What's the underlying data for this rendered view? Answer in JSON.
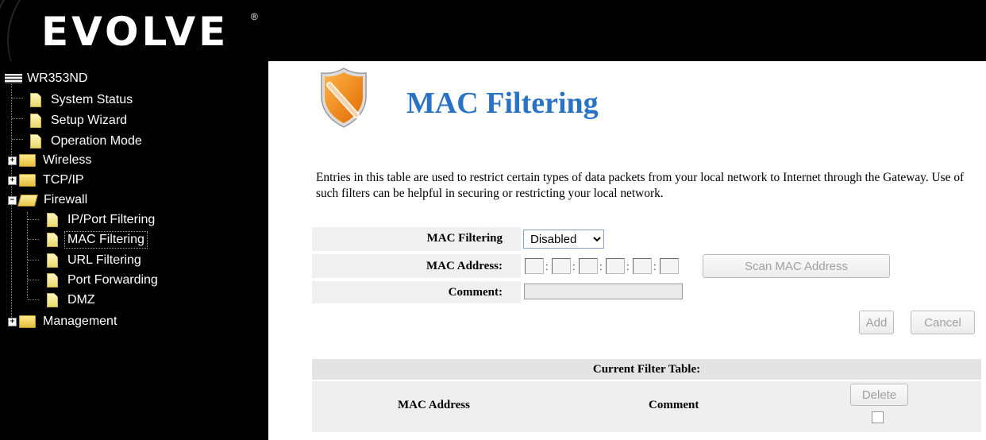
{
  "brand": {
    "logo_text": "EVOLVE",
    "registered_mark": "®"
  },
  "sidebar": {
    "root": "WR353ND",
    "items": [
      {
        "label": "System Status"
      },
      {
        "label": "Setup Wizard"
      },
      {
        "label": "Operation Mode"
      },
      {
        "label": "Wireless"
      },
      {
        "label": "TCP/IP"
      },
      {
        "label": "Firewall"
      },
      {
        "label": "IP/Port Filtering"
      },
      {
        "label": "MAC Filtering"
      },
      {
        "label": "URL Filtering"
      },
      {
        "label": "Port Forwarding"
      },
      {
        "label": "DMZ"
      },
      {
        "label": "Management"
      }
    ]
  },
  "page": {
    "title": "MAC Filtering",
    "description": "Entries in this table are used to restrict certain types of data packets from your local network to Internet through the Gateway. Use of such filters can be helpful in securing or restricting your local network."
  },
  "form": {
    "mac_filtering_label": "MAC Filtering",
    "mac_filtering_value": "Disabled",
    "mac_address_label": "MAC Address:",
    "mac_separator": ":",
    "scan_button": "Scan MAC Address",
    "comment_label": "Comment:",
    "add_button": "Add",
    "cancel_button": "Cancel"
  },
  "table": {
    "header": "Current Filter Table:",
    "col_mac": "MAC Address",
    "col_comment": "Comment",
    "delete_button": "Delete"
  },
  "colors": {
    "title": "#2a73c4",
    "sidebar_bg": "#000000",
    "icon_orange": "#f28c1c"
  }
}
